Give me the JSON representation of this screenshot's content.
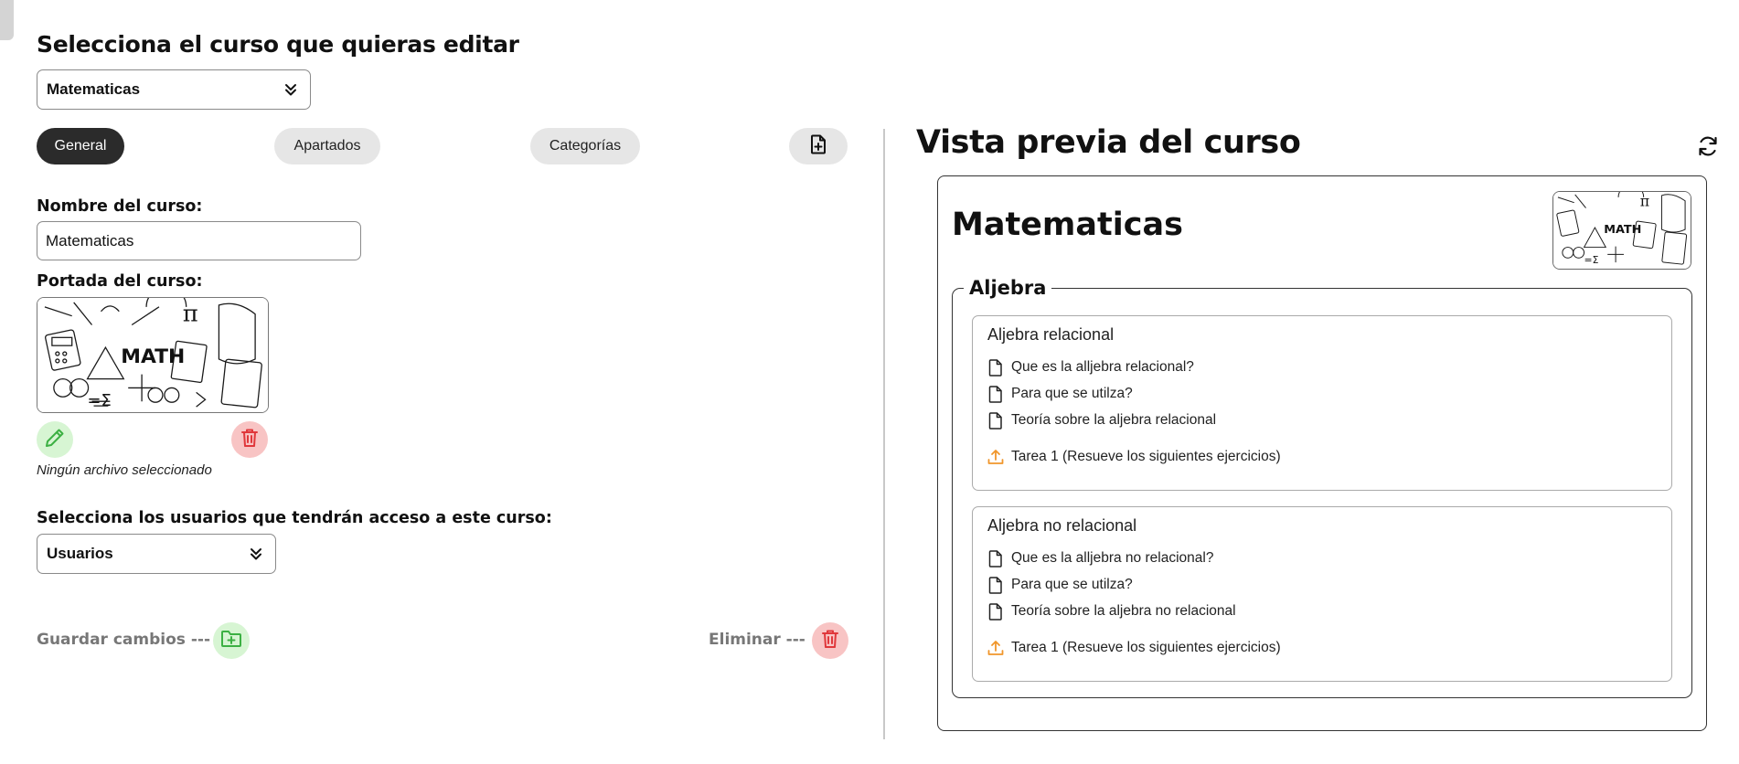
{
  "editor": {
    "title": "Selecciona el curso que quieras editar",
    "course_select": {
      "value": "Matematicas"
    },
    "tabs": [
      {
        "label": "General",
        "active": true
      },
      {
        "label": "Apartados",
        "active": false
      },
      {
        "label": "Categorías",
        "active": false
      }
    ],
    "new_file_icon": "file-plus-icon",
    "name_label": "Nombre del curso:",
    "name_value": "Matematicas",
    "cover_label": "Portada del curso:",
    "cover_art_text": "MATH",
    "cover_icons": {
      "edit": "pencil-icon",
      "delete": "trash-icon"
    },
    "no_file_text": "Ningún archivo seleccionado",
    "users_label": "Selecciona los usuarios que tendrán acceso a este curso:",
    "users_select": {
      "value": "Usuarios"
    },
    "save_label": "Guardar cambios ---",
    "delete_label": "Eliminar ---",
    "footer_icons": {
      "save": "folder-plus-icon",
      "delete": "trash-icon"
    }
  },
  "preview": {
    "title": "Vista previa del curso",
    "refresh_icon": "refresh-icon",
    "course_title": "Matematicas",
    "thumb_text": "MATH",
    "section": {
      "title": "Aljebra",
      "subsections": [
        {
          "title": "Aljebra relacional",
          "resources": [
            {
              "icon": "file-icon",
              "label": "Que es la alljebra relacional?"
            },
            {
              "icon": "file-icon",
              "label": "Para que se utilza?"
            },
            {
              "icon": "file-icon",
              "label": "Teoría sobre la aljebra relacional"
            },
            {
              "icon": "upload-icon",
              "label": "Tarea 1 (Resueve los siguientes ejercicios)"
            }
          ]
        },
        {
          "title": "Aljebra no relacional",
          "resources": [
            {
              "icon": "file-icon",
              "label": "Que es la alljebra no relacional?"
            },
            {
              "icon": "file-icon",
              "label": "Para que se utilza?"
            },
            {
              "icon": "file-icon",
              "label": "Teoría sobre la aljebra no relacional"
            },
            {
              "icon": "upload-icon",
              "label": "Tarea 1 (Resueve los siguientes ejercicios)"
            }
          ]
        }
      ]
    }
  },
  "colors": {
    "active_tab": "#2b2b2b",
    "inactive_tab": "#e6e6e6",
    "edit_green_bg": "#d7f5d3",
    "edit_green": "#3cb043",
    "delete_red_bg": "#f8c4c4",
    "delete_red": "#e0373b",
    "upload_orange": "#f0962b"
  }
}
